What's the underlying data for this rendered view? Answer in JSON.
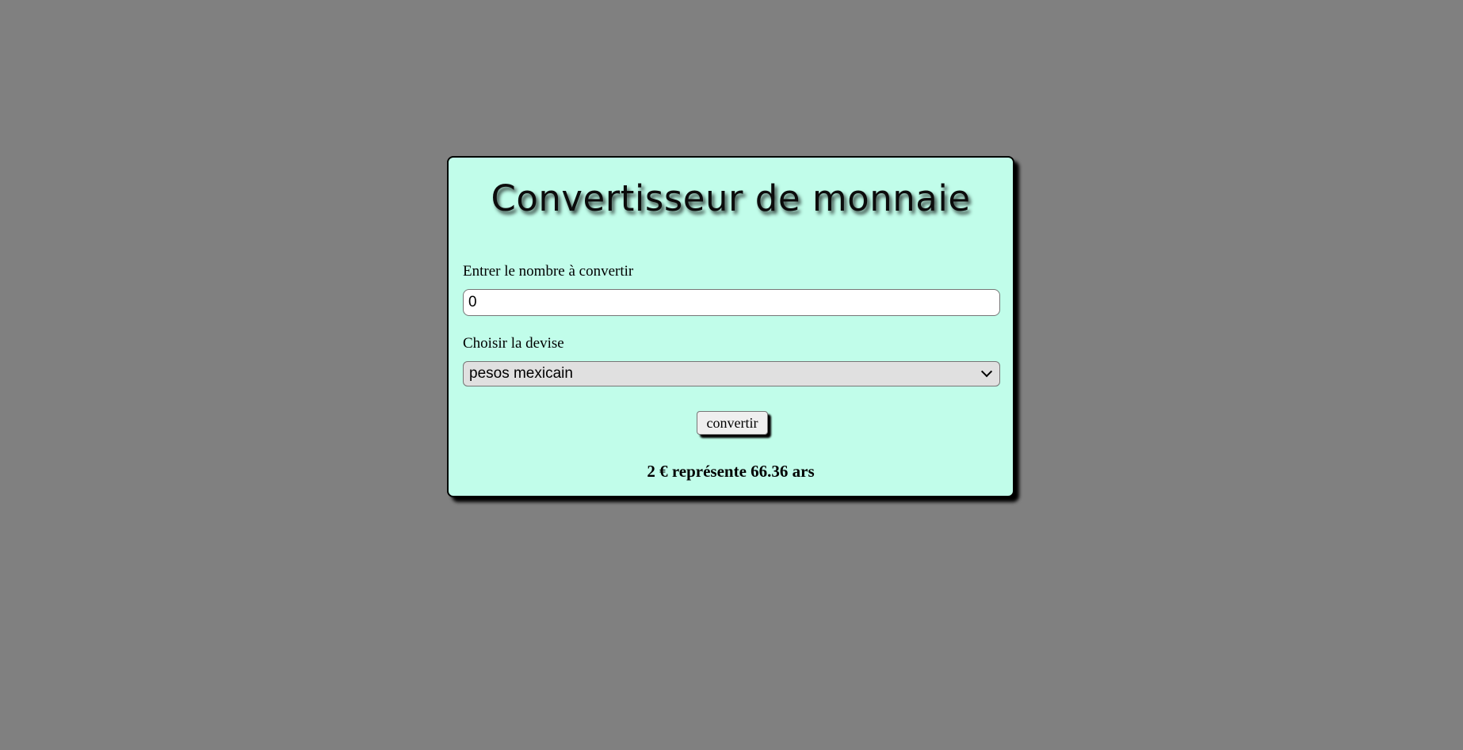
{
  "page": {
    "title": "Convertisseur de monnaie"
  },
  "form": {
    "amount_label": "Entrer le nombre à convertir",
    "amount_value": "0",
    "currency_label": "Choisir la devise",
    "currency_selected": "pesos mexicain",
    "convert_label": "convertir"
  },
  "result": {
    "text": "2 € représente 66.36 ars"
  },
  "icons": {
    "select_arrow": "chevron-down-icon"
  },
  "colors": {
    "background": "#808080",
    "card": "#c1fdea",
    "border": "#000000"
  }
}
